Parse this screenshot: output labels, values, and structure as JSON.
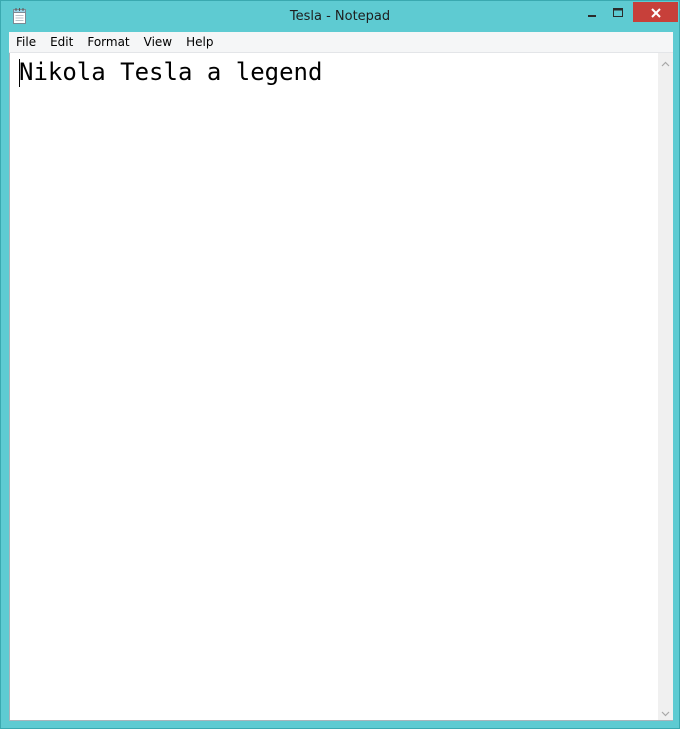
{
  "window": {
    "title": "Tesla - Notepad",
    "accent_color": "#5ecbd2",
    "close_color": "#c7403a"
  },
  "icons": {
    "app": "notepad-icon",
    "minimize": "minimize-icon",
    "maximize": "maximize-icon",
    "close": "close-icon",
    "scroll_up": "chevron-up-icon",
    "scroll_down": "chevron-down-icon"
  },
  "menu": {
    "file": "File",
    "edit": "Edit",
    "format": "Format",
    "view": "View",
    "help": "Help"
  },
  "document": {
    "content": "Nikola Tesla a legend"
  }
}
